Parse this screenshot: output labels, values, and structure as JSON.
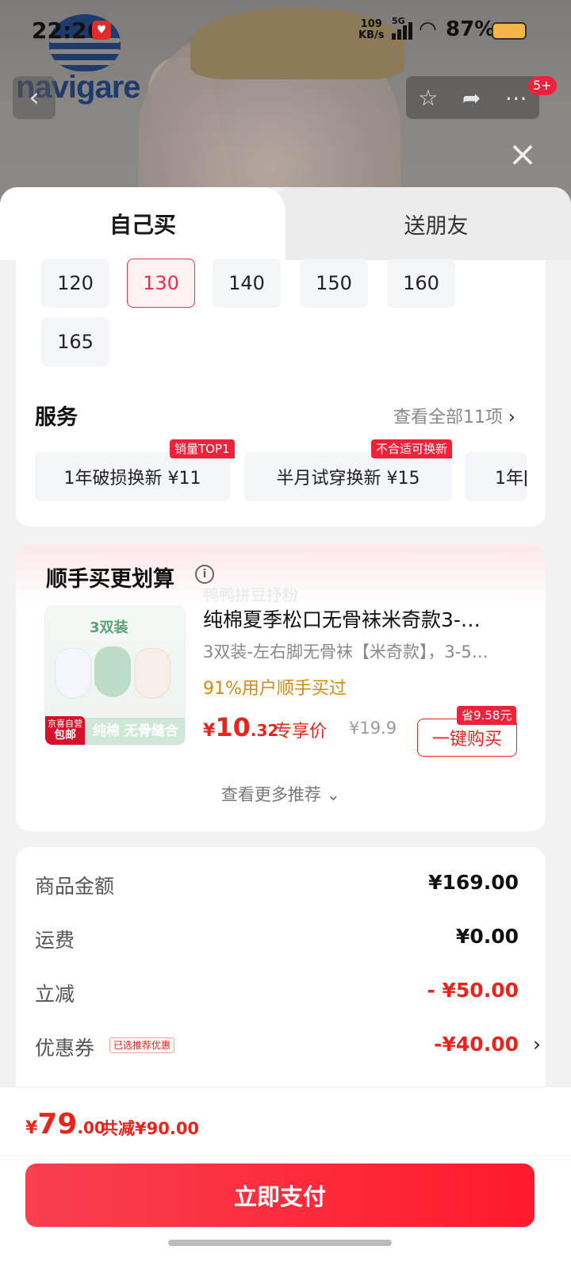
{
  "status_bar": {
    "time": "22:26",
    "net_speed_value": "109",
    "net_speed_unit": "KB/s",
    "network": "5G",
    "battery": "87%"
  },
  "brand": {
    "name": "navigare"
  },
  "header": {
    "cart_badge": "5+"
  },
  "tabs": {
    "self": "自己买",
    "gift": "送朋友"
  },
  "sizes": {
    "items": [
      "120",
      "130",
      "140",
      "150",
      "160",
      "165"
    ],
    "selected": "130"
  },
  "services": {
    "title": "服务",
    "see_all": "查看全部11项",
    "items": [
      {
        "label": "1年破损换新  ¥11",
        "tag": "销量TOP1"
      },
      {
        "label": "半月试穿换新  ¥15",
        "tag": "不合适可换新"
      },
      {
        "label": "1年[",
        "tag": ""
      }
    ]
  },
  "recommend": {
    "title": "顺手买更划算",
    "watermark": "鸭鸭拼豆抒粉",
    "product": {
      "name": "纯棉夏季松口无骨袜米奇款3-…",
      "desc": "3双装-左右脚无骨袜【米奇款】，3-5…",
      "buyers": "91%用户顺手买过",
      "price_symbol": "¥",
      "price_int": "10",
      "price_dec": ".32",
      "price_label": "专享价",
      "orig_price": "¥19.9",
      "save_tag": "省9.58元",
      "buy_button": "一键购买",
      "image_title": "3双装",
      "image_bar": "纯棉  无骨缝合",
      "image_badge_line1": "京喜自营",
      "image_badge_line2": "包邮"
    },
    "more": "查看更多推荐"
  },
  "summary": {
    "rows": [
      {
        "label": "商品金额",
        "value": "¥169.00",
        "red": false
      },
      {
        "label": "运费",
        "value": "¥0.00",
        "red": false
      },
      {
        "label": "立减",
        "value": "- ¥50.00",
        "red": true
      },
      {
        "label": "优惠券",
        "value": "-¥40.00",
        "red": true,
        "tag": "已选推荐优惠"
      }
    ]
  },
  "footer": {
    "total_symbol": "¥",
    "total_int": "79",
    "total_dec": ".00",
    "saved": "共减¥90.00",
    "pay_button": "立即支付"
  },
  "colors": {
    "accent": "#e8241d",
    "pay_button": "#f8404f",
    "tag_red": "#f0213a",
    "buyers_orange": "#d4890f"
  }
}
